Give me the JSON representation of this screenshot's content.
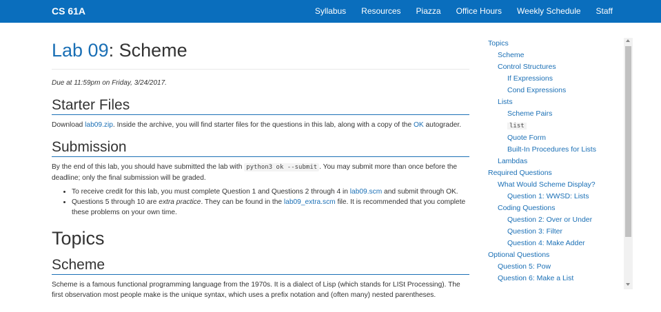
{
  "navbar": {
    "brand": "CS 61A",
    "links": [
      "Syllabus",
      "Resources",
      "Piazza",
      "Office Hours",
      "Weekly Schedule",
      "Staff"
    ]
  },
  "main": {
    "title_lab": "Lab 09",
    "title_rest": ": Scheme",
    "due": "Due at 11:59pm on Friday, 3/24/2017.",
    "starter": {
      "heading": "Starter Files",
      "text1": "Download ",
      "link_zip": "lab09.zip",
      "text2": ". Inside the archive, you will find starter files for the questions in this lab, along with a copy of the ",
      "link_ok": "OK",
      "text3": " autograder."
    },
    "submission": {
      "heading": "Submission",
      "text1": "By the end of this lab, you should have submitted the lab with ",
      "code": "python3 ok --submit",
      "text2": ". You may submit more than once before the deadline; only the final submission will be graded.",
      "bullet1_text1": "To receive credit for this lab, you must complete Question 1 and Questions 2 through 4 in ",
      "bullet1_link": "lab09.scm",
      "bullet1_text2": " and submit through OK.",
      "bullet2_text1": "Questions 5 through 10 are ",
      "bullet2_em": "extra practice",
      "bullet2_text2": ". They can be found in the ",
      "bullet2_link": "lab09_extra.scm",
      "bullet2_text3": " file. It is recommended that you complete these problems on your own time."
    },
    "topics_heading": "Topics",
    "scheme": {
      "heading": "Scheme",
      "text": "Scheme is a famous functional programming language from the 1970s. It is a dialect of Lisp (which stands for LISt Processing). The first observation most people make is the unique syntax, which uses a prefix notation and (often many) nested parentheses."
    }
  },
  "toc": [
    {
      "label": "Topics",
      "level": 0,
      "code": false
    },
    {
      "label": "Scheme",
      "level": 1,
      "code": false
    },
    {
      "label": "Control Structures",
      "level": 1,
      "code": false
    },
    {
      "label": "If Expressions",
      "level": 2,
      "code": false
    },
    {
      "label": "Cond Expressions",
      "level": 2,
      "code": false
    },
    {
      "label": "Lists",
      "level": 1,
      "code": false
    },
    {
      "label": "Scheme Pairs",
      "level": 2,
      "code": false
    },
    {
      "label": "list",
      "level": 2,
      "code": true
    },
    {
      "label": "Quote Form",
      "level": 2,
      "code": false
    },
    {
      "label": "Built-In Procedures for Lists",
      "level": 2,
      "code": false
    },
    {
      "label": "Lambdas",
      "level": 1,
      "code": false
    },
    {
      "label": "Required Questions",
      "level": 0,
      "code": false
    },
    {
      "label": "What Would Scheme Display?",
      "level": 1,
      "code": false
    },
    {
      "label": "Question 1: WWSD: Lists",
      "level": 2,
      "code": false
    },
    {
      "label": "Coding Questions",
      "level": 1,
      "code": false
    },
    {
      "label": "Question 2: Over or Under",
      "level": 2,
      "code": false
    },
    {
      "label": "Question 3: Filter",
      "level": 2,
      "code": false
    },
    {
      "label": "Question 4: Make Adder",
      "level": 2,
      "code": false
    },
    {
      "label": "Optional Questions",
      "level": 0,
      "code": false
    },
    {
      "label": "Question 5: Pow",
      "level": 1,
      "code": false
    },
    {
      "label": "Question 6: Make a List",
      "level": 1,
      "code": false
    }
  ]
}
